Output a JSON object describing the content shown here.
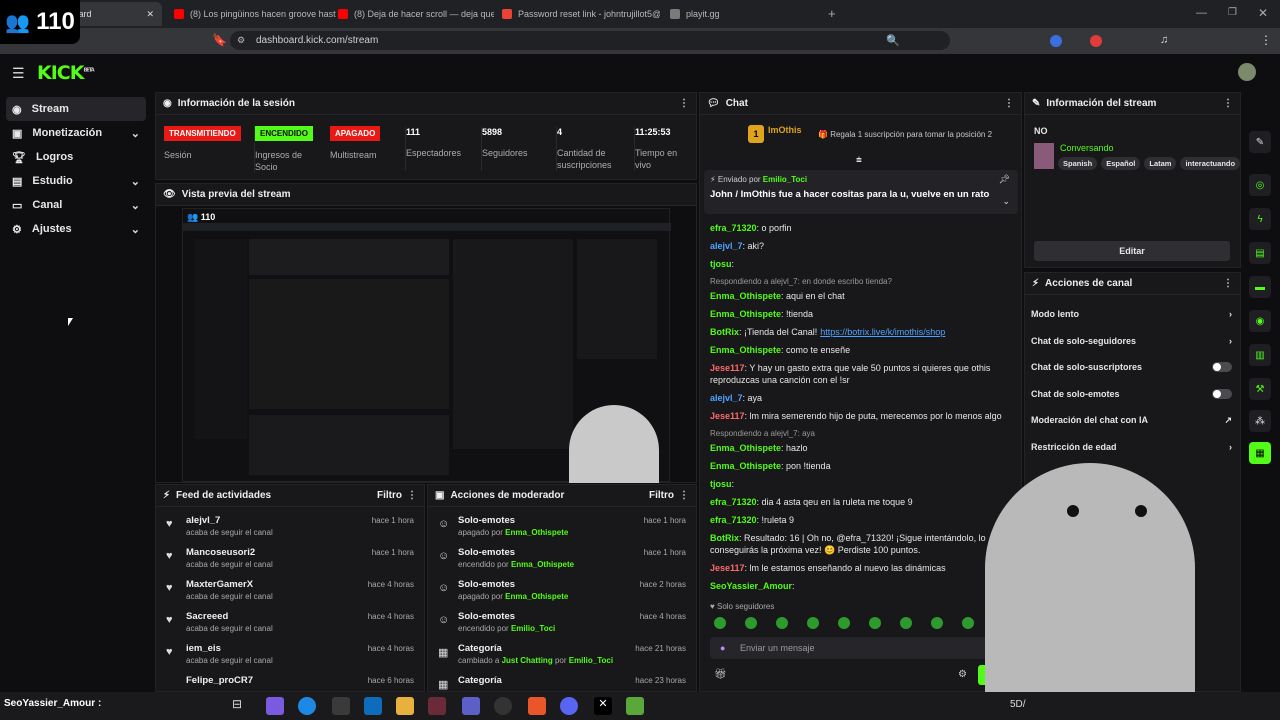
{
  "viewer_overlay": {
    "count": "110"
  },
  "browser": {
    "tabs": [
      {
        "title": "ashboard",
        "active": true
      },
      {
        "title": "(8) Los pingüinos hacen groove hast",
        "active": false
      },
      {
        "title": "(8) Deja de hacer scroll — deja que l",
        "active": false
      },
      {
        "title": "Password reset link - johntrujillot5@",
        "active": false
      },
      {
        "title": "playit.gg",
        "active": false
      }
    ],
    "url": "dashboard.kick.com/stream"
  },
  "app": {
    "logo": "KICK",
    "logo_beta": "BETA"
  },
  "sidebar": {
    "items": [
      {
        "label": "Stream",
        "icon": "broadcast-icon",
        "expandable": false
      },
      {
        "label": "Monetización",
        "icon": "money-icon",
        "expandable": true
      },
      {
        "label": "Logros",
        "icon": "trophy-icon",
        "expandable": false
      },
      {
        "label": "Estudio",
        "icon": "studio-icon",
        "expandable": true
      },
      {
        "label": "Canal",
        "icon": "channel-icon",
        "expandable": true
      },
      {
        "label": "Ajustes",
        "icon": "gear-icon",
        "expandable": true
      }
    ]
  },
  "session": {
    "title": "Información de la sesión",
    "stats": [
      {
        "badge": "TRANSMITIENDO",
        "badge_color": "#e91916",
        "label": "Sesión"
      },
      {
        "badge": "ENCENDIDO",
        "badge_color": "#53fc18",
        "label": "Ingresos de Socio"
      },
      {
        "badge": "APAGADO",
        "badge_color": "#e91916",
        "label": "Multistream"
      },
      {
        "value": "111",
        "label": "Espectadores"
      },
      {
        "value": "5898",
        "label": "Seguidores"
      },
      {
        "value": "4",
        "label": "Cantidad de suscripciones"
      },
      {
        "value": "11:25:53",
        "label": "Tiempo en vivo"
      }
    ]
  },
  "preview": {
    "title": "Vista previa del stream",
    "viewers": "110"
  },
  "feed": {
    "title": "Feed de actividades",
    "filter": "Filtro",
    "rows": [
      {
        "name": "alejvl_7",
        "sub": "acaba de seguir el canal",
        "time": "hace 1 hora"
      },
      {
        "name": "Mancoseusori2",
        "sub": "acaba de seguir el canal",
        "time": "hace 1 hora"
      },
      {
        "name": "MaxterGamerX",
        "sub": "acaba de seguir el canal",
        "time": "hace 4 horas"
      },
      {
        "name": "Sacreeed",
        "sub": "acaba de seguir el canal",
        "time": "hace 4 horas"
      },
      {
        "name": "iem_eis",
        "sub": "acaba de seguir el canal",
        "time": "hace 4 horas"
      },
      {
        "name": "Felipe_proCR7",
        "sub": "",
        "time": "hace 6 horas"
      }
    ]
  },
  "modactions": {
    "title": "Acciones de moderador",
    "filter": "Filtro",
    "rows": [
      {
        "name": "Solo-emotes",
        "sub": "apagado por",
        "who": "Enma_Othispete",
        "time": "hace 1 hora"
      },
      {
        "name": "Solo-emotes",
        "sub": "encendido por",
        "who": "Enma_Othispete",
        "time": "hace 1 hora"
      },
      {
        "name": "Solo-emotes",
        "sub": "apagado por",
        "who": "Enma_Othispete",
        "time": "hace 2 horas"
      },
      {
        "name": "Solo-emotes",
        "sub": "encendido por",
        "who": "Emilio_Toci",
        "time": "hace 4 horas"
      },
      {
        "name": "Categoría",
        "sub": "cambiado a",
        "sub2": "Just Chatting",
        "sub3": "por",
        "who": "Emilio_Toci",
        "time": "hace 21 horas"
      },
      {
        "name": "Categoría",
        "sub": "",
        "who": "",
        "time": "hace 23 horas"
      }
    ]
  },
  "chat": {
    "title": "Chat",
    "top_user": "ImOthis",
    "top_rank": "1",
    "top_text": "Regala 1 suscripción para tomar la posición 2",
    "pinned_by_label": "Enviado por",
    "pinned_by": "Emilio_Toci",
    "pinned_text": "John / ImOthis fue a hacer cositas para la u, vuelve en un rato",
    "messages": [
      {
        "user": "efra_71320",
        "cls": "u1",
        "text": ": o porfin"
      },
      {
        "user": "alejvl_7",
        "cls": "u2",
        "text": ": aki?"
      },
      {
        "user": "tjosu",
        "cls": "u1",
        "text": ":"
      },
      {
        "reply": "Respondiendo a alejvl_7: en donde escribo tienda?",
        "user": "Enma_Othispete",
        "cls": "u1",
        "text": ": aqui en el chat"
      },
      {
        "user": "Enma_Othispete",
        "cls": "u1",
        "text": ": !tienda"
      },
      {
        "user": "BotRix",
        "cls": "u1",
        "text": ": ¡Tienda del Canal!",
        "link": "https://botrix.live/k/imothis/shop"
      },
      {
        "user": "Enma_Othispete",
        "cls": "u1",
        "text": ": como te enseñe"
      },
      {
        "user": "Jese117",
        "cls": "u3",
        "text": ": Y hay un gasto extra que vale 50 puntos si quieres que othis reproduzcas una canción con el !sr"
      },
      {
        "user": "alejvl_7",
        "cls": "u2",
        "text": ": aya"
      },
      {
        "user": "Jese117",
        "cls": "u3",
        "text": ": lm mira semerendo hijo de puta, merecemos por lo menos algo"
      },
      {
        "reply": "Respondiendo a alejvl_7: aya",
        "user": "Enma_Othispete",
        "cls": "u1",
        "text": ": hazlo"
      },
      {
        "user": "Enma_Othispete",
        "cls": "u1",
        "text": ": pon !tienda"
      },
      {
        "user": "tjosu",
        "cls": "u1",
        "text": ":"
      },
      {
        "user": "efra_71320",
        "cls": "u1",
        "text": ": dia 4 asta qeu en la ruleta me toque 9"
      },
      {
        "user": "efra_71320",
        "cls": "u1",
        "text": ": !ruleta 9"
      },
      {
        "user": "BotRix",
        "cls": "u1",
        "text": ": Resultado: 16 | Oh no, @efra_71320! ¡Sigue intentándolo, lo conseguirás la próxima vez! 😊 Perdiste 100 puntos."
      },
      {
        "user": "Jese117",
        "cls": "u3",
        "text": ": lm le estamos enseñando al nuevo las dinámicas"
      },
      {
        "user": "SeoYassier_Amour",
        "cls": "u1",
        "text": ":"
      }
    ],
    "mode": "Solo seguidores",
    "input_placeholder": "Enviar un mensaje",
    "send": "Chat"
  },
  "stream_info": {
    "title": "Información del stream",
    "stream_title": "NO",
    "category": "Conversando",
    "tags": [
      "Spanish",
      "Español",
      "Latam",
      "interactuando"
    ],
    "edit": "Editar"
  },
  "channel_actions": {
    "title": "Acciones de canal",
    "rows": [
      {
        "label": "Modo lento",
        "kind": "arrow"
      },
      {
        "label": "Chat de solo-seguidores",
        "kind": "arrow"
      },
      {
        "label": "Chat de solo-suscriptores",
        "kind": "toggle"
      },
      {
        "label": "Chat de solo-emotes",
        "kind": "toggle"
      },
      {
        "label": "Moderación del chat con IA",
        "kind": "external"
      },
      {
        "label": "Restricción de edad",
        "kind": "arrow"
      }
    ]
  },
  "taskbar": {
    "user_label": "SeoYassier_Amour",
    "tray_text": "5D/"
  }
}
